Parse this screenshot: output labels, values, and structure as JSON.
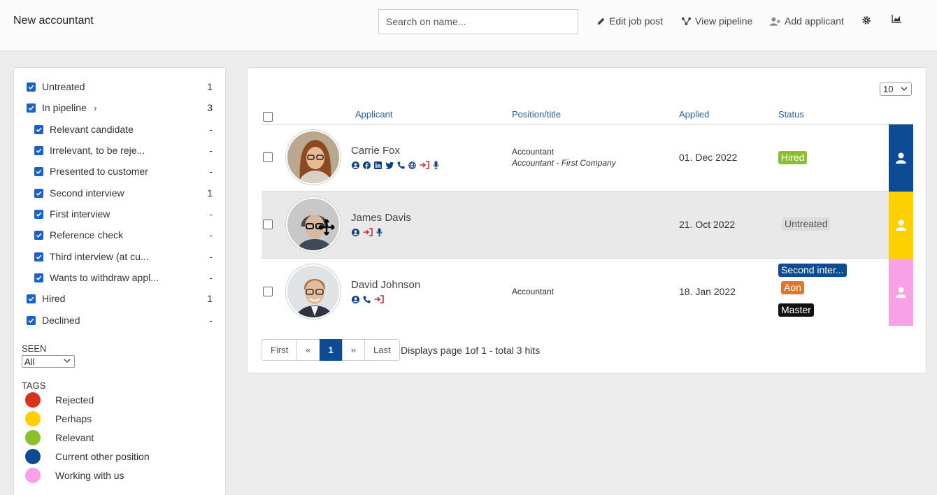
{
  "header": {
    "title": "New accountant",
    "search_placeholder": "Search on name...",
    "edit_job_post": "Edit job post",
    "view_pipeline": "View pipeline",
    "add_applicant": "Add applicant"
  },
  "sidebar": {
    "filters": [
      {
        "label": "Untreated",
        "count": "1"
      },
      {
        "label": "In pipeline",
        "count": "3"
      },
      {
        "label": "Relevant candidate",
        "count": "-"
      },
      {
        "label": "Irrelevant, to be reje...",
        "count": "-"
      },
      {
        "label": "Presented to customer",
        "count": "-"
      },
      {
        "label": "Second interview",
        "count": "1"
      },
      {
        "label": "First interview",
        "count": "-"
      },
      {
        "label": "Reference check",
        "count": "-"
      },
      {
        "label": "Third interview (at cu...",
        "count": "-"
      },
      {
        "label": "Wants to withdraw appl...",
        "count": "-"
      },
      {
        "label": "Hired",
        "count": "1"
      },
      {
        "label": "Declined",
        "count": "-"
      }
    ],
    "seen_label": "SEEN",
    "seen_value": "All",
    "tags_label": "TAGS",
    "tags": [
      {
        "label": "Rejected",
        "color": "#d9311c"
      },
      {
        "label": "Perhaps",
        "color": "#ffd000"
      },
      {
        "label": "Relevant",
        "color": "#8dbf2a"
      },
      {
        "label": "Current other position",
        "color": "#0d4c94"
      },
      {
        "label": "Working with us",
        "color": "#f7a1e6"
      }
    ]
  },
  "table": {
    "per_page": "10",
    "headers": {
      "applicant": "Applicant",
      "position": "Position/title",
      "applied": "Applied",
      "status": "Status"
    },
    "rows": [
      {
        "name": "Carrie Fox",
        "position": "Accountant",
        "position_detail": "Accountant - First Company",
        "applied": "01. Dec 2022",
        "status": [
          "Hired"
        ],
        "color": "#0d4c94"
      },
      {
        "name": "James Davis",
        "position": "",
        "position_detail": "",
        "applied": "21. Oct 2022",
        "status": [
          "Untreated"
        ],
        "color": "#ffd000"
      },
      {
        "name": "David Johnson",
        "position": "Accountant",
        "position_detail": "",
        "applied": "18. Jan 2022",
        "status": [
          "Second inter...",
          "Aon",
          "Master"
        ],
        "color": "#f7a1e6"
      }
    ]
  },
  "pagination": {
    "first": "First",
    "prev": "«",
    "current": "1",
    "next": "»",
    "last": "Last",
    "info_prefix": "Displays page ",
    "info_page": "1",
    "info_of": "of 1 - total ",
    "info_total": "3",
    "info_suffix": " hits"
  }
}
